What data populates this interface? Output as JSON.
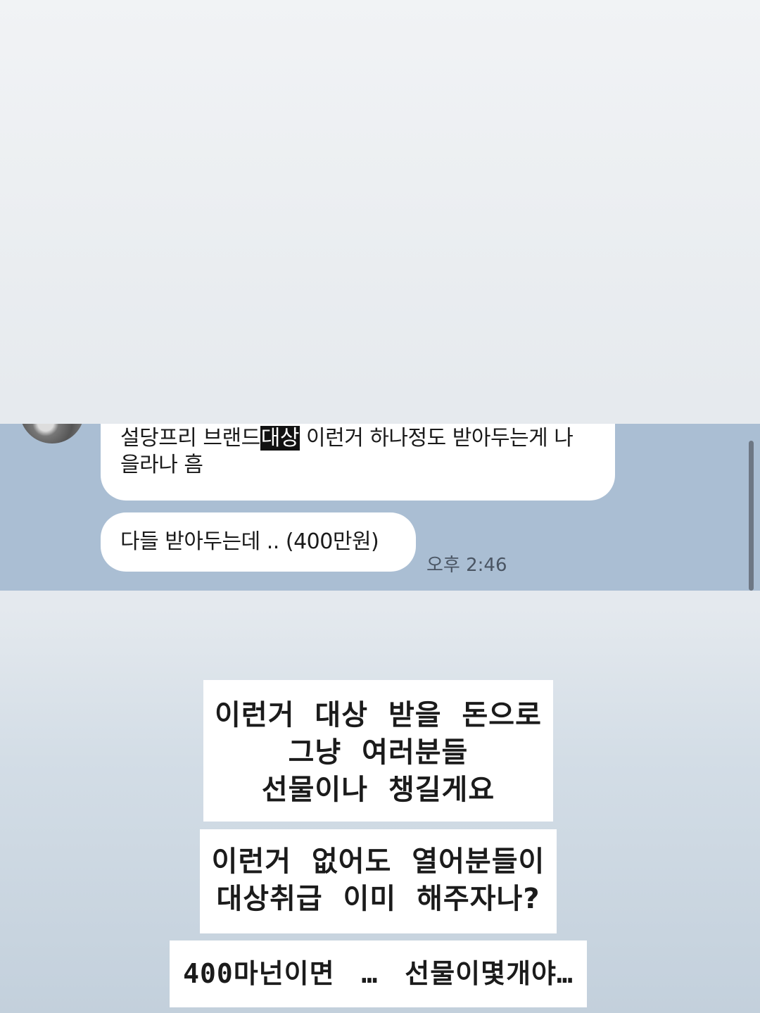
{
  "chat": {
    "messages": [
      {
        "line1_pre": "설당프리 브랜드",
        "line1_highlight": "대상",
        "line1_post": " 이런거 하나정도 받아두는게 나",
        "line2": "을라나 흠"
      },
      {
        "text": "다들 받아두는데 .. (400만원)"
      }
    ],
    "timestamp": "오후 2:46"
  },
  "captions": {
    "box1": [
      "이런거 대상 받을 돈으로",
      "그냥 여러분들",
      "선물이나 챙길게요"
    ],
    "box2": [
      "이런거 없어도 열어분들이",
      "대상취급 이미 해주자나?"
    ],
    "box3": [
      "400마넌이면 … 선물이몇개야…"
    ]
  },
  "colors": {
    "chat_background": "#aabed3",
    "bubble": "#ffffff",
    "highlight": "#111111"
  }
}
